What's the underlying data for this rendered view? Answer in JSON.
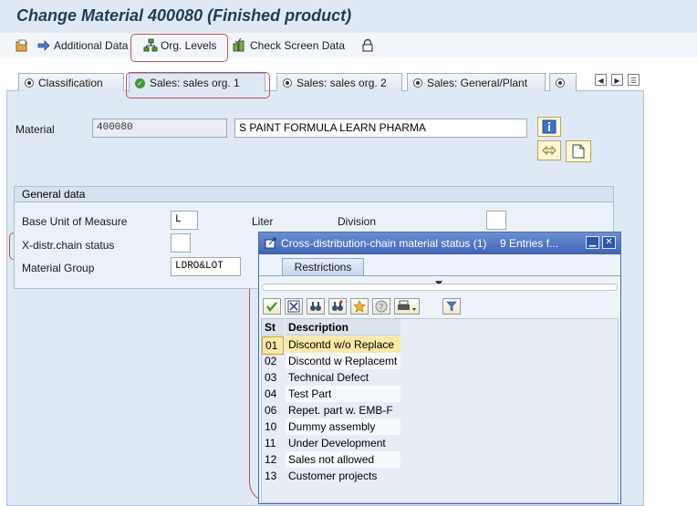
{
  "window": {
    "title": "Change Material 400080 (Finished product)"
  },
  "toolbar": {
    "items": [
      {
        "label": "",
        "icon": "save-icon"
      },
      {
        "label": "Additional Data",
        "icon": "arrow-right-icon"
      },
      {
        "label": "Org. Levels",
        "icon": "org-tree-icon"
      },
      {
        "label": "Check Screen Data",
        "icon": "check-screen-icon"
      },
      {
        "label": "",
        "icon": "lock-icon"
      }
    ]
  },
  "tabs": [
    {
      "label": "Classification",
      "icon": "radio-icon",
      "active": false
    },
    {
      "label": "Sales: sales org. 1",
      "icon": "check-icon",
      "active": true
    },
    {
      "label": "Sales: sales org. 2",
      "icon": "radio-icon",
      "active": false
    },
    {
      "label": "Sales: General/Plant",
      "icon": "radio-icon",
      "active": false
    }
  ],
  "material": {
    "label": "Material",
    "number": "400080",
    "description": "S PAINT FORMULA LEARN PHARMA"
  },
  "general_data": {
    "heading": "General data",
    "base_uom_label": "Base Unit of Measure",
    "base_uom_value": "L",
    "base_uom_text": "Liter",
    "division_label": "Division",
    "division_value": "",
    "xdistr_label": "X-distr.chain status",
    "xdistr_value": "",
    "material_group_label": "Material Group",
    "material_group_value": "LDRO&LOT"
  },
  "popup": {
    "title": "Cross-distribution-chain material status (1)",
    "entries": "9 Entries f...",
    "restrictions_tab": "Restrictions",
    "col_status": "St",
    "col_desc": "Description",
    "rows": [
      {
        "st": "01",
        "desc": "Discontd w/o Replace",
        "selected": true
      },
      {
        "st": "02",
        "desc": "Discontd w Replacemt",
        "selected": false
      },
      {
        "st": "03",
        "desc": "Technical Defect",
        "selected": false
      },
      {
        "st": "04",
        "desc": "Test Part",
        "selected": false
      },
      {
        "st": "06",
        "desc": "Repet. part w. EMB-F",
        "selected": false
      },
      {
        "st": "10",
        "desc": "Dummy assembly",
        "selected": false
      },
      {
        "st": "11",
        "desc": "Under Development",
        "selected": false
      },
      {
        "st": "12",
        "desc": "Sales not allowed",
        "selected": false
      },
      {
        "st": "13",
        "desc": "Customer projects",
        "selected": false
      }
    ]
  },
  "colors": {
    "annotation": "#c0504d",
    "selected_row": "#fde9a6",
    "popup_title": "#3e63b5"
  }
}
